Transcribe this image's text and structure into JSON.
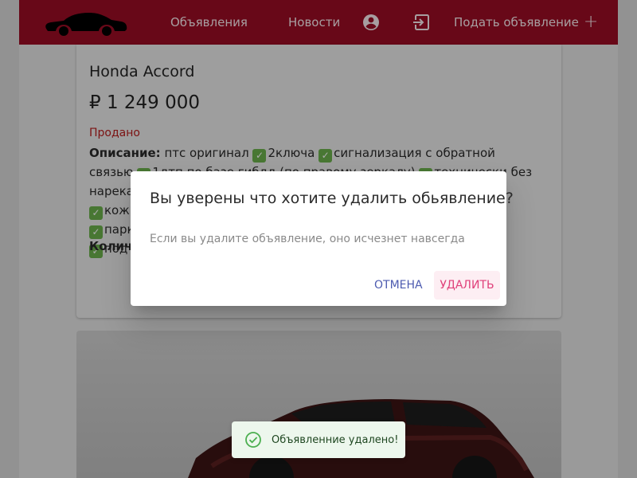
{
  "header": {
    "nav_ads": "Объявления",
    "nav_news": "Новости",
    "profile_icon": "account-circle-icon",
    "logout_icon": "logout-icon",
    "post_ad_label": "Подать объявление",
    "post_ad_icon": "+",
    "brand_color": "#9a0c24"
  },
  "listing": {
    "title": "Honda Accord",
    "price": "₽ 1 249 000",
    "status": "Продано",
    "description_label": "Описание:",
    "description_text": "птс оригинал",
    "features": [
      "2ключа",
      "сигнализация с обратной связью",
      "1дтп по базе гибдд (по правому зеркалу)",
      "технически без нареканий",
      "кож",
      "парк",
      "под"
    ],
    "count_label": "Колич"
  },
  "dialog": {
    "title": "Вы уверены что хотите удалить обьявление?",
    "text": "Если вы удалите объявление, оно исчезнет навсегда",
    "cancel_label": "ОТМЕНА",
    "delete_label": "УДАЛИТЬ",
    "cancel_color": "#4d5bb0",
    "delete_color": "#e0407a"
  },
  "toast": {
    "icon": "check-circle-icon",
    "text": "Объявленние удалено!",
    "color": "#2e7d32"
  }
}
